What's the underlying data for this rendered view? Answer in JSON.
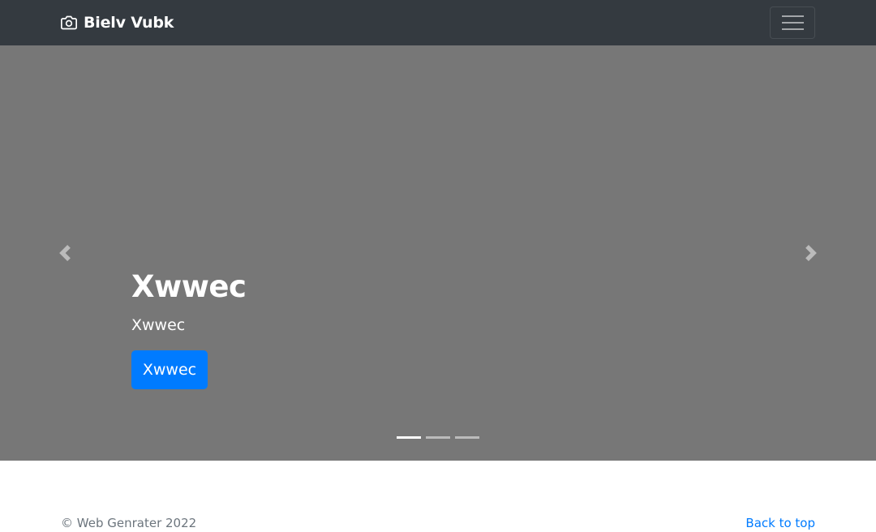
{
  "navbar": {
    "brand_icon": "camera-icon",
    "brand_label": "Bielv Vubk",
    "toggler_icon": "hamburger-menu-icon"
  },
  "carousel": {
    "slide_title": "Xwwec",
    "slide_text": "Xwwec",
    "slide_button_label": "Xwwec",
    "prev_icon": "chevron-left-icon",
    "next_icon": "chevron-right-icon",
    "slide_count": 3,
    "active_slide": 1
  },
  "footer": {
    "copyright": "© Web Genrater 2022",
    "back_to_top": "Back to top"
  },
  "colors": {
    "navbar_bg": "#343a40",
    "carousel_bg": "#777777",
    "primary": "#007bff",
    "muted_text": "#6c757d"
  }
}
